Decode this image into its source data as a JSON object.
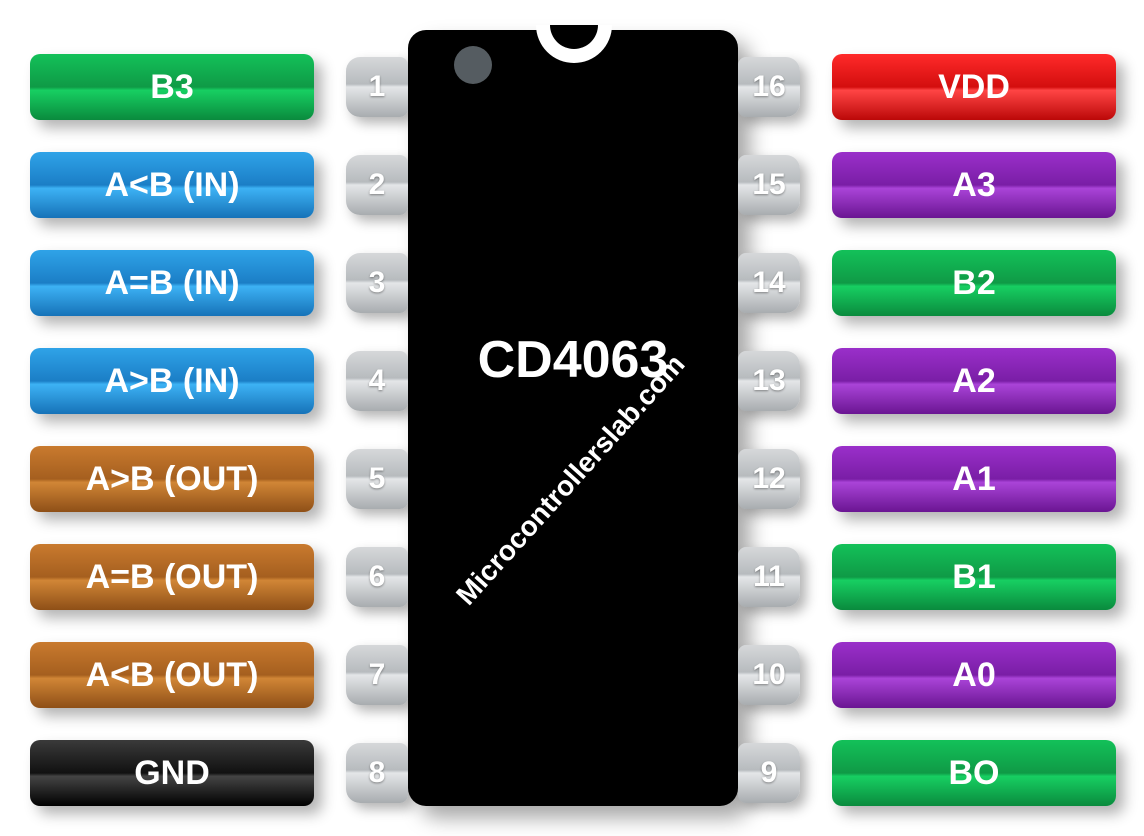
{
  "chip": {
    "name": "CD4063",
    "watermark": "Microcontrollerslab.com"
  },
  "left_pins": [
    {
      "num": "1",
      "label": "B3",
      "color": "green"
    },
    {
      "num": "2",
      "label": "A<B (IN)",
      "color": "blue"
    },
    {
      "num": "3",
      "label": "A=B (IN)",
      "color": "blue"
    },
    {
      "num": "4",
      "label": "A>B (IN)",
      "color": "blue"
    },
    {
      "num": "5",
      "label": "A>B (OUT)",
      "color": "brown"
    },
    {
      "num": "6",
      "label": "A=B (OUT)",
      "color": "brown"
    },
    {
      "num": "7",
      "label": "A<B (OUT)",
      "color": "brown"
    },
    {
      "num": "8",
      "label": "GND",
      "color": "black"
    }
  ],
  "right_pins": [
    {
      "num": "16",
      "label": "VDD",
      "color": "red"
    },
    {
      "num": "15",
      "label": "A3",
      "color": "purple"
    },
    {
      "num": "14",
      "label": "B2",
      "color": "green"
    },
    {
      "num": "13",
      "label": "A2",
      "color": "purple"
    },
    {
      "num": "12",
      "label": "A1",
      "color": "purple"
    },
    {
      "num": "11",
      "label": "B1",
      "color": "green"
    },
    {
      "num": "10",
      "label": "A0",
      "color": "purple"
    },
    {
      "num": "9",
      "label": "BO",
      "color": "green"
    }
  ]
}
